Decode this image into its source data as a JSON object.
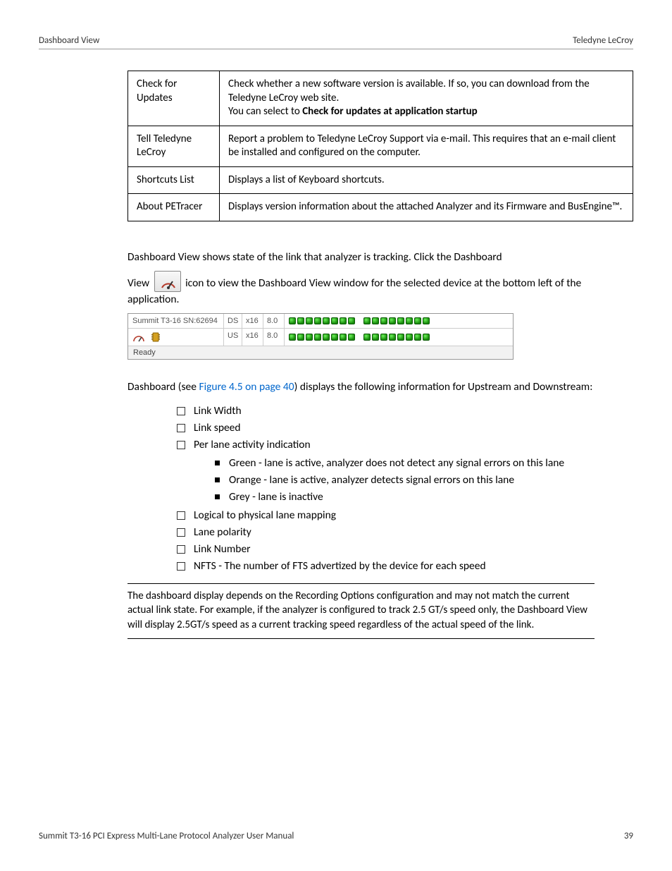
{
  "header": {
    "left": "Dashboard View",
    "right": "Teledyne LeCroy"
  },
  "table": {
    "rows": [
      {
        "label": "Check for Updates",
        "desc_pre": "Check whether a new software version is available. If so, you can download from the Teledyne LeCroy web site.\nYou can select to ",
        "desc_bold": "Check for updates at application startup"
      },
      {
        "label": "Tell Teledyne LeCroy",
        "desc": "Report a problem to Teledyne LeCroy Support via e-mail. This requires that an e-mail client be installed and configured on the computer."
      },
      {
        "label": "Shortcuts List",
        "desc": "Displays a list of Keyboard shortcuts."
      },
      {
        "label": "About PETracer",
        "desc": "Displays version information about the attached Analyzer and its Firmware and BusEngine™."
      }
    ]
  },
  "intro1_a": "Dashboard View shows state of the link that analyzer is tracking. Click the Dashboard",
  "intro1_b": "View ",
  "intro1_c": " icon to view the Dashboard View window for the selected device at the bottom left of the application.",
  "screenshot": {
    "device": "Summit T3-16 SN:62694",
    "rows": [
      {
        "dir": "DS",
        "width": "x16",
        "speed": "8.0"
      },
      {
        "dir": "US",
        "width": "x16",
        "speed": "8.0"
      }
    ],
    "status": "Ready"
  },
  "intro2_a": "Dashboard (see ",
  "intro2_link": "Figure 4.5 on page 40",
  "intro2_b": ") displays the following information for Upstream and Downstream:",
  "list": {
    "items": [
      "Link Width",
      "Link speed",
      "Per lane activity indication",
      "Logical to physical lane mapping",
      "Lane polarity",
      "Link Number",
      "NFTS - The number of FTS advertized by the device for each speed"
    ],
    "sub": [
      "Green - lane is active, analyzer does not detect any signal errors on this lane",
      "Orange - lane is active, analyzer detects signal errors on this lane",
      "Grey - lane is inactive"
    ]
  },
  "note": "The dashboard display depends on the Recording Options configuration and may not match the current actual link state. For example, if the analyzer is configured to track 2.5 GT/s speed only, the Dashboard View will display 2.5GT/s speed as a current tracking speed regardless of the actual speed of the link.",
  "footer": {
    "left": "Summit T3-16 PCI Express Multi-Lane Protocol Analyzer User Manual",
    "right": "39"
  }
}
